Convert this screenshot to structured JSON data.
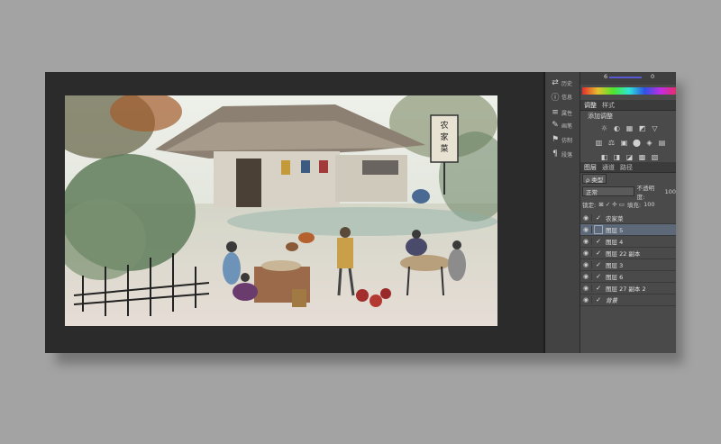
{
  "dock": {
    "items": [
      {
        "glyph": "⇄",
        "label": "历史"
      },
      {
        "glyph": "ⓘ",
        "label": "信息"
      },
      {
        "glyph": "≡",
        "label": "属性"
      },
      {
        "glyph": "✎",
        "label": "画笔"
      },
      {
        "glyph": "⚑",
        "label": "仿制"
      },
      {
        "glyph": "¶",
        "label": "段落"
      }
    ]
  },
  "color_panel": {
    "value_left": "6",
    "value_right": "0"
  },
  "adjustments": {
    "tabs": [
      "调整",
      "样式"
    ],
    "add_label": "添加调整",
    "row1": [
      "☼",
      "◐",
      "▦",
      "◩",
      "▽"
    ],
    "row2": [
      "▥",
      "⚖",
      "▣",
      "⬤",
      "◈",
      "▤"
    ],
    "row3": [
      "◧",
      "◨",
      "◪",
      "▩",
      "▧"
    ]
  },
  "layers_panel": {
    "tabs": [
      "图层",
      "通道",
      "路径"
    ],
    "filter_label": "ρ 类型",
    "blend_mode": "正常",
    "opacity_label": "不透明度:",
    "opacity_value": "100",
    "lock_label": "锁定:",
    "fill_label": "填充:",
    "fill_value": "100",
    "items": [
      {
        "name": "农家菜",
        "selected": false
      },
      {
        "name": "图层 5",
        "selected": true
      },
      {
        "name": "图层 4",
        "selected": false
      },
      {
        "name": "图层 22 副本",
        "selected": false
      },
      {
        "name": "图层 3",
        "selected": false
      },
      {
        "name": "图层 6",
        "selected": false
      },
      {
        "name": "图层 27 副本 2",
        "selected": false
      },
      {
        "name": "背景",
        "selected": false
      }
    ]
  },
  "artwork": {
    "sign_text": "农家菜"
  }
}
